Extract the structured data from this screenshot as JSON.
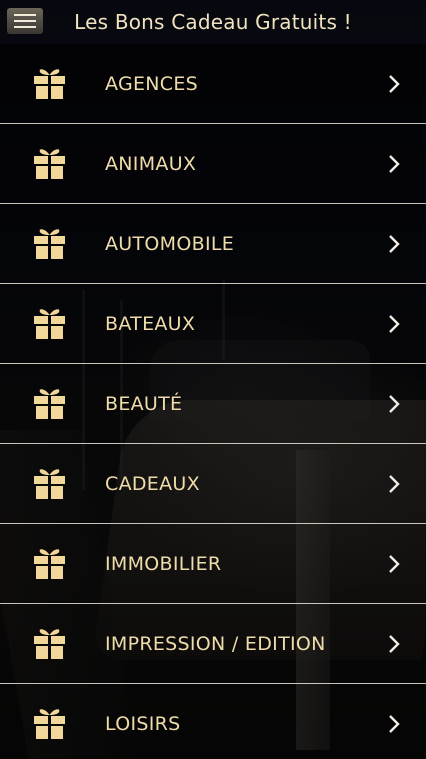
{
  "header": {
    "title": "Les Bons Cadeau Gratuits !",
    "menu_icon": "hamburger-menu-icon"
  },
  "accent_color": "#efdcaa",
  "icon_color": "#f1d79a",
  "categories": [
    {
      "label": "AGENCES",
      "icon": "gift-icon"
    },
    {
      "label": "ANIMAUX",
      "icon": "gift-icon"
    },
    {
      "label": "AUTOMOBILE",
      "icon": "gift-icon"
    },
    {
      "label": "BATEAUX",
      "icon": "gift-icon"
    },
    {
      "label": "BEAUTÉ",
      "icon": "gift-icon"
    },
    {
      "label": "CADEAUX",
      "icon": "gift-icon"
    },
    {
      "label": "IMMOBILIER",
      "icon": "gift-icon"
    },
    {
      "label": "IMPRESSION / EDITION",
      "icon": "gift-icon"
    },
    {
      "label": "LOISIRS",
      "icon": "gift-icon"
    }
  ]
}
